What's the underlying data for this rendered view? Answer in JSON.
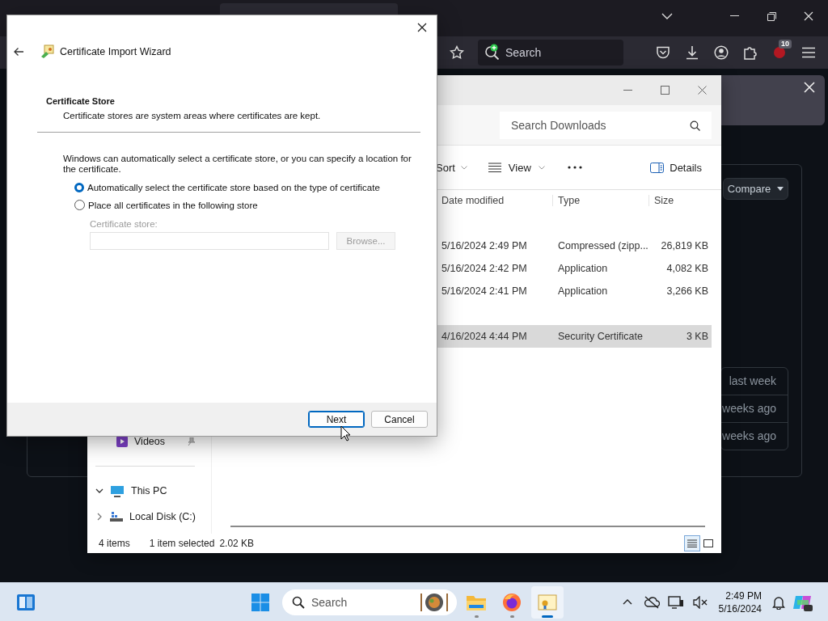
{
  "browser": {
    "search": {
      "placeholder": "Search"
    },
    "extension_badge": "10"
  },
  "web_page": {
    "compare_button": "Compare",
    "list": [
      "last week",
      "weeks ago",
      "weeks ago"
    ]
  },
  "explorer": {
    "search": {
      "placeholder": "Search Downloads"
    },
    "toolbar": {
      "sort": "Sort",
      "view": "View",
      "details": "Details"
    },
    "columns": [
      "Date modified",
      "Type",
      "Size"
    ],
    "groups": [
      {
        "files": [
          {
            "date": "5/16/2024 2:49 PM",
            "type": "Compressed (zipp...",
            "size": "26,819 KB",
            "selected": false
          },
          {
            "date": "5/16/2024 2:42 PM",
            "type": "Application",
            "size": "4,082 KB",
            "selected": false
          },
          {
            "date": "5/16/2024 2:41 PM",
            "type": "Application",
            "size": "3,266 KB",
            "selected": false
          }
        ]
      },
      {
        "files": [
          {
            "date": "4/16/2024 4:44 PM",
            "type": "Security Certificate",
            "size": "3 KB",
            "selected": true
          }
        ]
      }
    ],
    "nav": [
      {
        "label": "Videos",
        "kind": "pinned"
      },
      {
        "label": "This PC",
        "kind": "tree",
        "expanded": true,
        "children": [
          {
            "label": "Local Disk (C:)",
            "expanded": false
          }
        ]
      }
    ],
    "status": {
      "items": "4 items",
      "selection": "1 item selected",
      "size": "2.02 KB"
    },
    "view_buttons": [
      {
        "kind": "details",
        "selected": true
      },
      {
        "kind": "tiles",
        "selected": false
      }
    ]
  },
  "dialog": {
    "title": "Certificate Import Wizard",
    "heading": "Certificate Store",
    "subtitle": "Certificate stores are system areas where certificates are kept.",
    "description": "Windows can automatically select a certificate store, or you can specify a location for the certificate.",
    "options": [
      {
        "label": "Automatically select the certificate store based on the type of certificate",
        "selected": true
      },
      {
        "label": "Place all certificates in the following store",
        "selected": false
      }
    ],
    "store_field": {
      "label": "Certificate store:",
      "disabled": true
    },
    "browse_button": {
      "label": "Browse...",
      "disabled": true
    },
    "buttons": [
      {
        "label": "Next",
        "kind": "default"
      },
      {
        "label": "Cancel",
        "kind": "normal"
      }
    ]
  },
  "taskbar": {
    "search": {
      "placeholder": "Search"
    },
    "time": "2:49 PM",
    "date": "5/16/2024"
  }
}
